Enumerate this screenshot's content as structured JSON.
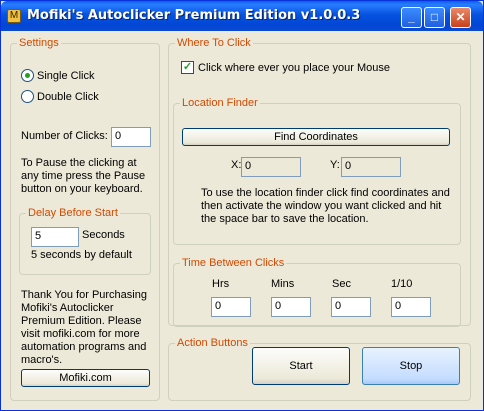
{
  "window": {
    "title": "Mofiki's Autoclicker Premium Edition v1.0.0.3",
    "buttons": {
      "minimize": "_",
      "maximize": "□",
      "close": "✕"
    }
  },
  "settings": {
    "label": "Settings",
    "single_click": "Single Click",
    "double_click": "Double Click",
    "selected": "Single Click",
    "num_clicks_label": "Number of Clicks:",
    "num_clicks_value": "0",
    "pause_text": "To Pause the clicking at any time press the Pause button on your keyboard."
  },
  "delay": {
    "label": "Delay Before Start",
    "value": "5",
    "unit": "Seconds",
    "note": "5 seconds by default"
  },
  "thanks": {
    "text": "Thank You for Purchasing Mofiki's Autoclicker Premium Edition.  Please visit mofiki.com for more automation programs and macro's.",
    "link_button": "Mofiki.com"
  },
  "where_to_click": {
    "label": "Where To Click",
    "checkbox_label": "Click where ever you place your Mouse",
    "checked": true
  },
  "location_finder": {
    "label": "Location Finder",
    "find_button": "Find Coordinates",
    "x_label": "X:",
    "x_value": "0",
    "y_label": "Y:",
    "y_value": "0",
    "instructions": "To use the location finder click find coordinates and then activate the window you want clicked and hit the space bar to save the location."
  },
  "time_between": {
    "label": "Time Between Clicks",
    "hrs_label": "Hrs",
    "mins_label": "Mins",
    "sec_label": "Sec",
    "tenth_label": "1/10",
    "hrs": "0",
    "mins": "0",
    "sec": "0",
    "tenth": "0"
  },
  "actions": {
    "label": "Action Buttons",
    "start": "Start",
    "stop": "Stop"
  }
}
